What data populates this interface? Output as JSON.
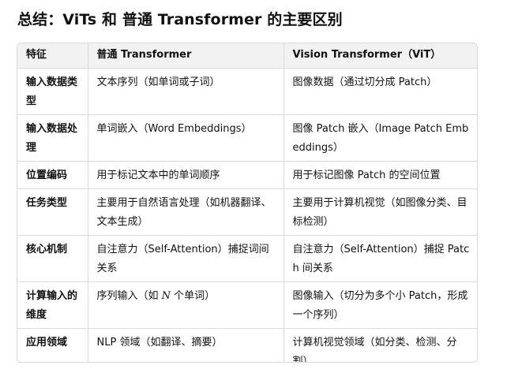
{
  "title": "总结：ViTs 和 普通 Transformer 的主要区别",
  "table": {
    "headers": [
      "特征",
      "普通 Transformer",
      "Vision Transformer（ViT）"
    ],
    "rows": [
      {
        "feature": "输入数据类型",
        "transformer": "文本序列（如单词或子词）",
        "vit": "图像数据（通过切分成 Patch）"
      },
      {
        "feature": "输入数据处理",
        "transformer": "单词嵌入（Word Embeddings）",
        "vit": "图像 Patch 嵌入（Image Patch Embeddings）"
      },
      {
        "feature": "位置编码",
        "transformer": "用于标记文本中的单词顺序",
        "vit": "用于标记图像 Patch 的空间位置"
      },
      {
        "feature": "任务类型",
        "transformer": "主要用于自然语言处理（如机器翻译、文本生成）",
        "vit": "主要用于计算机视觉（如图像分类、目标检测）"
      },
      {
        "feature": "核心机制",
        "transformer": "自注意力（Self-Attention）捕捉词间关系",
        "vit": "自注意力（Self-Attention）捕捉 Patch 间关系"
      },
      {
        "feature": "计算输入的维度",
        "transformer_prefix": "序列输入（如",
        "transformer_math": "N",
        "transformer_suffix": "个单词）",
        "vit": "图像输入（切分为多个小 Patch，形成一个序列）"
      },
      {
        "feature": "应用领域",
        "transformer": "NLP 领域（如翻译、摘要）",
        "vit": "计算机视觉领域（如分类、检测、分割）"
      }
    ]
  }
}
